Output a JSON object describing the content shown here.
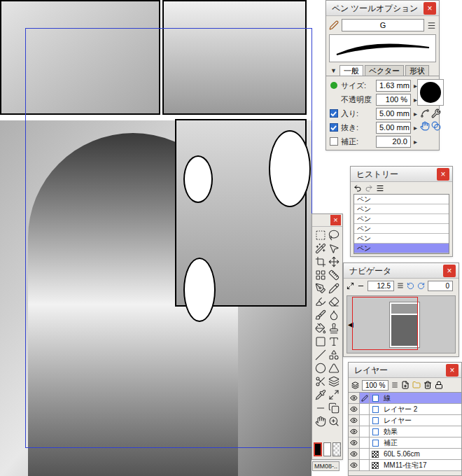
{
  "pen_options": {
    "title": "ペン ツールオプション",
    "close": "×",
    "preset": "G",
    "tab_arrow": "▼",
    "tabs": [
      {
        "label": "一般",
        "selected": true
      },
      {
        "label": "ベクター",
        "selected": false
      },
      {
        "label": "形状",
        "selected": false
      }
    ],
    "arrow": "▸",
    "fields": [
      {
        "label": "サイズ:",
        "value": "1.63 mm",
        "kind": "dot",
        "checked": true
      },
      {
        "label": "不透明度",
        "value": "100 %",
        "kind": "plain",
        "checked": false
      },
      {
        "label": "入り:",
        "value": "5.00 mm",
        "kind": "checkbox",
        "checked": true
      },
      {
        "label": "抜き:",
        "value": "5.00 mm",
        "kind": "checkbox",
        "checked": true
      },
      {
        "label": "補正:",
        "value": "20.0",
        "kind": "checkbox",
        "checked": false
      }
    ]
  },
  "history": {
    "title": "ヒストリー",
    "close": "×",
    "items": [
      {
        "label": "ペン",
        "selected": false
      },
      {
        "label": "ペン",
        "selected": false
      },
      {
        "label": "ペン",
        "selected": false
      },
      {
        "label": "ペン",
        "selected": false
      },
      {
        "label": "ペン",
        "selected": false
      },
      {
        "label": "ペン",
        "selected": true
      }
    ]
  },
  "tools": {
    "close": "×",
    "footer": "MM08-.."
  },
  "navigator": {
    "title": "ナビゲータ",
    "close": "×",
    "zoom": "12.5",
    "rotation": "0",
    "arrow": "◀"
  },
  "layers": {
    "title": "レイヤー",
    "close": "×",
    "opacity": "100 %",
    "rows": [
      {
        "name": "線",
        "selected": true,
        "kind": "raster"
      },
      {
        "name": "レイヤー 2",
        "selected": false,
        "kind": "raster"
      },
      {
        "name": "レイヤー",
        "selected": false,
        "kind": "raster"
      },
      {
        "name": "効果",
        "selected": false,
        "kind": "raster"
      },
      {
        "name": "補正",
        "selected": false,
        "kind": "raster"
      },
      {
        "name": "60L 5.06cm",
        "selected": false,
        "kind": "tone"
      },
      {
        "name": "MM11-住宅17",
        "selected": false,
        "kind": "tone"
      }
    ]
  }
}
